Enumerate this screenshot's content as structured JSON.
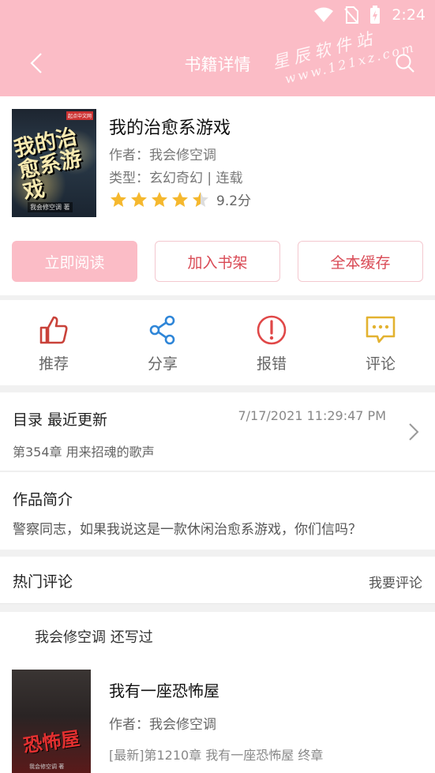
{
  "status_bar": {
    "time": "2:24"
  },
  "header": {
    "title": "书籍详情",
    "watermark_line1": "星辰软件站",
    "watermark_line2": "www.121xz.com"
  },
  "book": {
    "title": "我的治愈系游戏",
    "author_label": "作者：我会修空调",
    "type_label": "类型：玄幻奇幻 | 连载",
    "rating": 4.5,
    "rating_text": "9.2分",
    "cover_title": "我的治愈系游戏",
    "cover_author": "我会修空调 著",
    "cover_badge": "起点中文网"
  },
  "buttons": {
    "read": "立即阅读",
    "shelf": "加入书架",
    "cache": "全本缓存"
  },
  "actions": [
    {
      "label": "推荐",
      "icon": "thumbs-up-icon",
      "color": "#c9423a"
    },
    {
      "label": "分享",
      "icon": "share-icon",
      "color": "#2f86d8"
    },
    {
      "label": "报错",
      "icon": "error-icon",
      "color": "#e04848"
    },
    {
      "label": "评论",
      "icon": "comment-icon",
      "color": "#e3b230"
    }
  ],
  "catalog": {
    "title": "目录  最近更新",
    "updated": "7/17/2021 11:29:47 PM",
    "latest_chapter": "第354章 用来招魂的歌声"
  },
  "intro": {
    "title": "作品简介",
    "text": "警察同志，如果我说这是一款休闲治愈系游戏，你们信吗？"
  },
  "comments": {
    "title": "热门评论",
    "action": "我要评论"
  },
  "also_wrote": {
    "title": "我会修空调  还写过",
    "book_title": "我有一座恐怖屋",
    "author": "作者：我会修空调",
    "latest": "[最新]第1210章 我有一座恐怖屋 终章",
    "cover_title": "恐怖屋",
    "cover_author": "我会修空调 著"
  },
  "colors": {
    "header_bg": "#fbbcc6",
    "accent": "#d94a55",
    "star": "#f5b82e"
  }
}
